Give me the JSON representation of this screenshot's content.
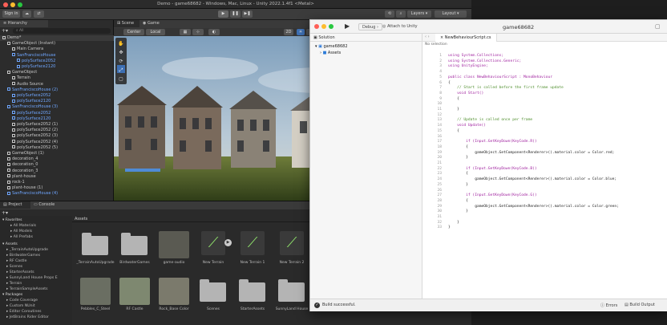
{
  "unity": {
    "title": "Demo - game68682 - Windows, Mac, Linux - Unity 2022.1.4f1 <Metal>",
    "toolbar": {
      "signin": "Sign in",
      "layers": "Layers",
      "layout": "Layout"
    },
    "hierarchy": {
      "tab": "Hierarchy",
      "search": "All",
      "rows": [
        {
          "label": "Demo*",
          "indent": 0,
          "blue": false
        },
        {
          "label": "GameObject (Instant)",
          "indent": 1,
          "blue": false
        },
        {
          "label": "Main Camera",
          "indent": 2,
          "blue": false
        },
        {
          "label": "SanFranciscoHouse",
          "indent": 2,
          "blue": true
        },
        {
          "label": "polySurface2052",
          "indent": 3,
          "blue": true
        },
        {
          "label": "polySurface2120",
          "indent": 3,
          "blue": true
        },
        {
          "label": "GameObject",
          "indent": 1,
          "blue": false
        },
        {
          "label": "Terrain",
          "indent": 2,
          "blue": false
        },
        {
          "label": "Audio Source",
          "indent": 2,
          "blue": false
        },
        {
          "label": "SanFranciscoHouse (2)",
          "indent": 1,
          "blue": true
        },
        {
          "label": "polySurface2052",
          "indent": 2,
          "blue": true
        },
        {
          "label": "polySurface2120",
          "indent": 2,
          "blue": true
        },
        {
          "label": "SanFranciscoHouse (3)",
          "indent": 1,
          "blue": true
        },
        {
          "label": "polySurface2052",
          "indent": 2,
          "blue": true
        },
        {
          "label": "polySurface2120",
          "indent": 2,
          "blue": true
        },
        {
          "label": "polySurface2052 (1)",
          "indent": 2,
          "blue": false
        },
        {
          "label": "polySurface2052 (2)",
          "indent": 2,
          "blue": false
        },
        {
          "label": "polySurface2052 (3)",
          "indent": 2,
          "blue": false
        },
        {
          "label": "polySurface2052 (4)",
          "indent": 2,
          "blue": false
        },
        {
          "label": "polySurface2052 (5)",
          "indent": 2,
          "blue": false
        },
        {
          "label": "GameObject (1)",
          "indent": 1,
          "blue": false
        },
        {
          "label": "decoration_4",
          "indent": 1,
          "blue": false
        },
        {
          "label": "decoration_0",
          "indent": 1,
          "blue": false
        },
        {
          "label": "decoration_3",
          "indent": 1,
          "blue": false
        },
        {
          "label": "plant-house",
          "indent": 1,
          "blue": false
        },
        {
          "label": "rock-1",
          "indent": 1,
          "blue": false
        },
        {
          "label": "plant-house (1)",
          "indent": 1,
          "blue": false
        },
        {
          "label": "SanFranciscoHouse (4)",
          "indent": 1,
          "blue": true
        }
      ]
    },
    "scene": {
      "tab_scene": "Scene",
      "tab_game": "Game",
      "center": "Center",
      "local": "Local",
      "mode_2d": "2D",
      "tabs_right": "≡"
    },
    "project": {
      "tab_project": "Project",
      "tab_console": "Console",
      "favorites_header": "Favorites",
      "favorites": [
        "All Materials",
        "All Models",
        "All Prefabs"
      ],
      "assets_header": "Assets",
      "asset_tree": [
        "_TerrainAutoUpgrade",
        "BirdwaterGames",
        "RF Castle",
        "Scenes",
        "StarterAssets",
        "SunnyLand House Props E",
        "Terrain",
        "TerrainSampleAssets"
      ],
      "packages_header": "Packages",
      "packages": [
        "Code Coverage",
        "Custom NUnit",
        "Editor Coroutines",
        "JetBrains Rider Editor"
      ],
      "breadcrumb": "Assets",
      "assets_row1": [
        "_TerrainAutoUpgrade",
        "BirdwaterGames",
        "game-audio",
        "New Terrain",
        "New Terrain 1",
        "New Terrain 2"
      ],
      "assets_row2": [
        "Pebbles_C_Steel",
        "RF Castle",
        "Rock_Base Color",
        "Scenes",
        "StarterAssets",
        "SunnyLand House"
      ]
    }
  },
  "xcode": {
    "window_title": "game68682",
    "scheme": "Debug",
    "attach": "Attach to Unity",
    "solution_label": "Solution",
    "project_name": "game68682",
    "assets_folder": "Assets",
    "tab_name": "NewBehaviourScript.cs",
    "breadcrumb": "No selection",
    "code_lines": [
      "using System.Collections;",
      "using System.Collections.Generic;",
      "using UnityEngine;",
      "",
      "public class NewBehaviourScript : MonoBehaviour",
      "{",
      "    // Start is called before the first frame update",
      "    void Start()",
      "    {",
      "",
      "    }",
      "",
      "    // Update is called once per frame",
      "    void Update()",
      "    {",
      "",
      "        if (Input.GetKeyDown(KeyCode.R))",
      "        {",
      "            gameObject.GetComponent<Renderer>().material.color = Color.red;",
      "        }",
      "",
      "        if (Input.GetKeyDown(KeyCode.B))",
      "        {",
      "            gameObject.GetComponent<Renderer>().material.color = Color.blue;",
      "        }",
      "",
      "        if (Input.GetKeyDown(KeyCode.G))",
      "        {",
      "            gameObject.GetComponent<Renderer>().material.color = Color.green;",
      "        }",
      "",
      "    }",
      "}"
    ],
    "status_left": "Build successful.",
    "status_errors": "Errors",
    "status_output": "Build Output"
  },
  "colors": {
    "unity_bg": "#2c2c2c",
    "selection_blue": "#6fa6ff",
    "xcode_keyword": "#a0229f",
    "xcode_comment": "#4e8e2c",
    "xcode_type": "#1d6fd6",
    "mac_red": "#ff5f57",
    "mac_yellow": "#febc2e",
    "mac_green": "#28c840"
  }
}
